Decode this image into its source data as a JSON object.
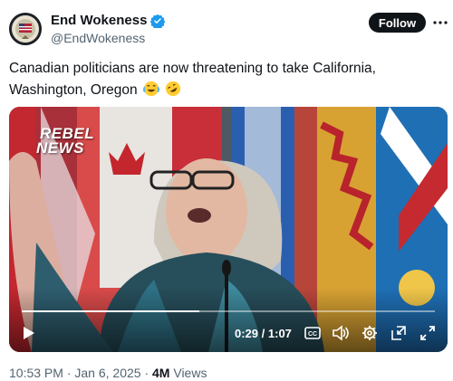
{
  "author": {
    "display_name": "End Wokeness",
    "handle": "@EndWokeness",
    "verified": true,
    "avatar_icon": "avatar-seal-image"
  },
  "actions": {
    "follow_label": "Follow",
    "more_icon": "more-horizontal-icon"
  },
  "tweet": {
    "text": "Canadian politicians are now threatening to take California, Washington, Oregon",
    "emojis": [
      "face-with-tears-of-joy",
      "rolling-on-floor-laughing"
    ]
  },
  "video": {
    "watermark_line1": "REBEL",
    "watermark_line2": "NEWS",
    "current_time": "0:29",
    "duration": "1:07",
    "progress": 0.43,
    "controls": [
      "play-icon",
      "captions-icon",
      "volume-icon",
      "settings-icon",
      "pop-out-icon",
      "fullscreen-icon"
    ]
  },
  "footer": {
    "time": "10:53 PM",
    "separator": "·",
    "date": "Jan 6, 2025",
    "views_count": "4M",
    "views_label": "Views"
  },
  "colors": {
    "text_primary": "#0f1419",
    "text_secondary": "#536471",
    "verified_blue": "#1d9bf0",
    "follow_bg": "#0f1419"
  }
}
